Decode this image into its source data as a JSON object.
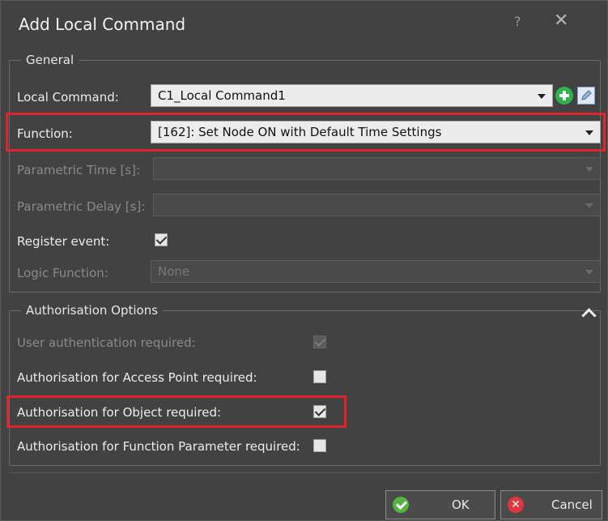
{
  "window": {
    "title": "Add Local Command",
    "help_glyph": "?",
    "close_glyph": "✕"
  },
  "general": {
    "legend": "General",
    "local_command": {
      "label": "Local Command:",
      "value": "C1_Local Command1"
    },
    "function": {
      "label": "Function:",
      "value": "[162]: Set Node ON with Default Time Settings"
    },
    "parametric_time": {
      "label": "Parametric Time [s]:",
      "value": ""
    },
    "parametric_delay": {
      "label": "Parametric Delay [s]:",
      "value": ""
    },
    "register_event": {
      "label": "Register event:",
      "checked": true
    },
    "logic_function": {
      "label": "Logic Function:",
      "value": "None"
    }
  },
  "authorisation": {
    "legend": "Authorisation Options",
    "user_auth": {
      "label": "User authentication required:",
      "checked": true
    },
    "access_point": {
      "label": "Authorisation for Access Point required:",
      "checked": false
    },
    "object": {
      "label": "Authorisation for Object required:",
      "checked": true
    },
    "function_param": {
      "label": "Authorisation for Function Parameter required:",
      "checked": false
    }
  },
  "buttons": {
    "ok": "OK",
    "cancel": "Cancel",
    "cancel_glyph": "✕"
  },
  "colors": {
    "highlight": "#e0242b",
    "add_green": "#2eb24a",
    "ok_green": "#55b441",
    "cancel_red": "#e2363e",
    "dialog_bg": "#424242"
  }
}
